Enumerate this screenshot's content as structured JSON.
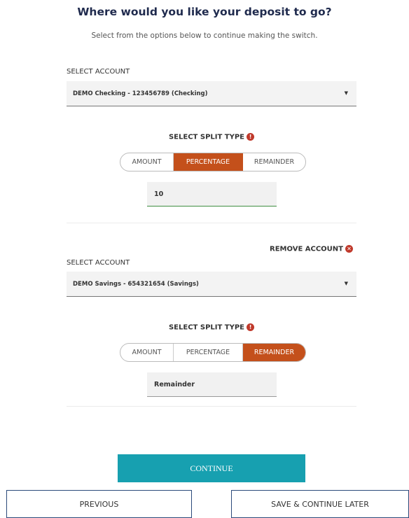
{
  "header": {
    "title": "Where would you like your deposit to go?",
    "subtitle": "Select from the options below to continue making the switch."
  },
  "accounts": [
    {
      "select_label": "SELECT ACCOUNT",
      "selected_value": "DEMO Checking - 123456789 (Checking)",
      "split_title": "SELECT SPLIT TYPE",
      "split_options": [
        "AMOUNT",
        "PERCENTAGE",
        "REMAINDER"
      ],
      "active_split": "PERCENTAGE",
      "input_value": "10"
    },
    {
      "remove_label": "REMOVE ACCOUNT",
      "select_label": "SELECT ACCOUNT",
      "selected_value": "DEMO Savings - 654321654 (Savings)",
      "split_title": "SELECT SPLIT TYPE",
      "split_options": [
        "AMOUNT",
        "PERCENTAGE",
        "REMAINDER"
      ],
      "active_split": "REMAINDER",
      "input_value": "Remainder"
    }
  ],
  "footer": {
    "continue_label": "CONTINUE",
    "previous_label": "PREVIOUS",
    "save_label": "SAVE & CONTINUE LATER"
  },
  "colors": {
    "accent": "#c4501b",
    "continue": "#17a0b0",
    "title": "#1f2a4d",
    "error_icon": "#c0392b"
  },
  "icons": {
    "info": "info-circle-icon",
    "remove": "close-circle-icon",
    "caret": "caret-down-icon"
  }
}
